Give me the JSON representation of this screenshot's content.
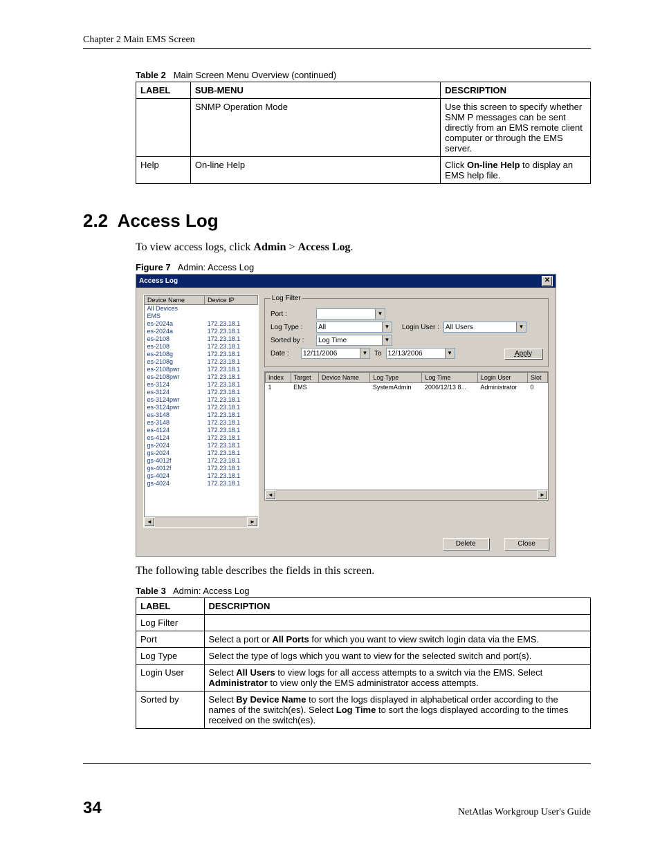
{
  "chapter_header": "Chapter 2 Main EMS Screen",
  "table2": {
    "caption_label": "Table 2",
    "caption_text": "Main Screen Menu Overview (continued)",
    "headers": {
      "col1": "LABEL",
      "col2": "SUB-MENU",
      "col3": "DESCRIPTION"
    },
    "rows": [
      {
        "label": "",
        "submenu": "SNMP Operation Mode",
        "desc": "Use this screen to specify whether SNM P messages can be sent directly from an EMS remote client computer or through the EMS server."
      },
      {
        "label": "Help",
        "submenu": "On-line Help",
        "desc_pre": "Click ",
        "desc_bold": "On-line Help",
        "desc_post": " to display an EMS help file."
      }
    ]
  },
  "section": {
    "number": "2.2",
    "title": "Access Log",
    "intro_pre": "To view access logs, click ",
    "intro_b1": "Admin",
    "intro_mid": " > ",
    "intro_b2": "Access Log",
    "intro_post": "."
  },
  "figure": {
    "caption_label": "Figure 7",
    "caption_text": "Admin: Access Log",
    "window_title": "Access Log",
    "device_headers": {
      "name": "Device Name",
      "ip": "Device IP"
    },
    "devices": [
      {
        "name": "All Devices",
        "ip": ""
      },
      {
        "name": "EMS",
        "ip": ""
      },
      {
        "name": "es-2024a",
        "ip": "172.23.18.1"
      },
      {
        "name": "es-2024a",
        "ip": "172.23.18.1"
      },
      {
        "name": "es-2108",
        "ip": "172.23.18.1"
      },
      {
        "name": "es-2108",
        "ip": "172.23.18.1"
      },
      {
        "name": "es-2108g",
        "ip": "172.23.18.1"
      },
      {
        "name": "es-2108g",
        "ip": "172.23.18.1"
      },
      {
        "name": "es-2108pwr",
        "ip": "172.23.18.1"
      },
      {
        "name": "es-2108pwr",
        "ip": "172.23.18.1"
      },
      {
        "name": "es-3124",
        "ip": "172.23.18.1"
      },
      {
        "name": "es-3124",
        "ip": "172.23.18.1"
      },
      {
        "name": "es-3124pwr",
        "ip": "172.23.18.1"
      },
      {
        "name": "es-3124pwr",
        "ip": "172.23.18.1"
      },
      {
        "name": "es-3148",
        "ip": "172.23.18.1"
      },
      {
        "name": "es-3148",
        "ip": "172.23.18.1"
      },
      {
        "name": "es-4124",
        "ip": "172.23.18.1"
      },
      {
        "name": "es-4124",
        "ip": "172.23.18.1"
      },
      {
        "name": "gs-2024",
        "ip": "172.23.18.1"
      },
      {
        "name": "gs-2024",
        "ip": "172.23.18.1"
      },
      {
        "name": "gs-4012f",
        "ip": "172.23.18.1"
      },
      {
        "name": "gs-4012f",
        "ip": "172.23.18.1"
      },
      {
        "name": "gs-4024",
        "ip": "172.23.18.1"
      },
      {
        "name": "gs-4024",
        "ip": "172.23.18.1"
      }
    ],
    "filter": {
      "legend": "Log Filter",
      "port_label": "Port :",
      "port_value": "",
      "logtype_label": "Log Type :",
      "logtype_value": "All",
      "loginuser_label": "Login User :",
      "loginuser_value": "All Users",
      "sortedby_label": "Sorted by :",
      "sortedby_value": "Log Time",
      "date_label": "Date :",
      "date_from": "12/11/2006",
      "date_to_label": "To",
      "date_to": "12/13/2006",
      "apply_label": "Apply"
    },
    "log_headers": {
      "index": "Index",
      "target": "Target",
      "devname": "Device Name",
      "logtype": "Log Type",
      "logtime": "Log Time",
      "loginuser": "Login User",
      "slot": "Slot"
    },
    "log_rows": [
      {
        "index": "1",
        "target": "EMS",
        "devname": "",
        "logtype": "SystemAdmin",
        "logtime": "2006/12/13 8...",
        "loginuser": "Administrator",
        "slot": "0"
      }
    ],
    "buttons": {
      "delete": "Delete",
      "close": "Close"
    }
  },
  "after_figure": "The following table describes the fields in this screen.",
  "table3": {
    "caption_label": "Table 3",
    "caption_text": "Admin: Access Log",
    "headers": {
      "col1": "LABEL",
      "col2": "DESCRIPTION"
    },
    "rows": [
      {
        "label": "Log Filter",
        "desc": ""
      },
      {
        "label": "Port",
        "desc_pre": "Select a port or ",
        "desc_b1": "All Ports",
        "desc_post": " for which you want to view switch login data via the EMS."
      },
      {
        "label": "Log Type",
        "desc": "Select the type of logs which you want to view for the selected switch and port(s)."
      },
      {
        "label": "Login User",
        "desc_pre": "Select ",
        "desc_b1": "All Users",
        "desc_mid": " to view logs for all access attempts to a switch via the EMS. Select ",
        "desc_b2": "Administrator",
        "desc_post": " to view only the EMS administrator access attempts."
      },
      {
        "label": "Sorted by",
        "desc_pre": "Select ",
        "desc_b1": "By Device Name",
        "desc_mid": " to sort the logs displayed in alphabetical order according to the names of the switch(es). Select ",
        "desc_b2": "Log Time",
        "desc_post": " to sort the logs displayed according to the times received on the switch(es)."
      }
    ]
  },
  "footer": {
    "page": "34",
    "guide": "NetAtlas Workgroup User's Guide"
  }
}
